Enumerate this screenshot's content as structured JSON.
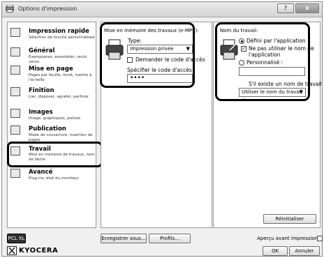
{
  "window": {
    "title": "Options d'impression",
    "help_label": "?",
    "close_label": "x"
  },
  "sidebar": {
    "items": [
      {
        "title": "Impression rapide",
        "desc": "Sélection de touche personnalisée"
      },
      {
        "title": "Général",
        "desc": "Exemplaires, assembler, recto verso"
      },
      {
        "title": "Mise en page",
        "desc": "Pages par feuille, livret, mettre à l'échelle"
      },
      {
        "title": "Finition",
        "desc": "Lier, disposer, agrafer, perforer"
      },
      {
        "title": "Images",
        "desc": "Image, graphiques, polices"
      },
      {
        "title": "Publication",
        "desc": "Mode de couverture, insertion de pages"
      },
      {
        "title": "Travail",
        "desc": "Mise en mémoire de travaux, nom de tâche"
      },
      {
        "title": "Avancé",
        "desc": "Plug-ins, état du moniteur"
      }
    ]
  },
  "job_storage": {
    "group_title": "Mise en mémoire des travaux (e-MPS):",
    "type_label": "Type:",
    "type_value": "Impression privée",
    "ask_code_label": "Demander le code d'accès",
    "specify_code_label": "Spécifier le code d'accès",
    "code_value": "••••"
  },
  "job_name": {
    "group_title": "Nom du travail:",
    "app_defined_label": "Défini par l'application",
    "no_user_name_line1": "Ne pas utiliser le nom de",
    "no_user_name_line2": "l'application",
    "custom_label": "Personnalisé :",
    "custom_value": "",
    "exists_label": "S'il existe un nom de travail :",
    "exists_value": "Utiliser le nom du travail +"
  },
  "buttons": {
    "reset": "Réinitialiser",
    "pcl": "PCL XL",
    "save_as": "Enregistrer sous...",
    "profiles": "Profils...",
    "preview": "Aperçu avant impression",
    "ok": "OK",
    "cancel": "Annuler"
  },
  "brand": {
    "logo": "KYOCERA"
  }
}
